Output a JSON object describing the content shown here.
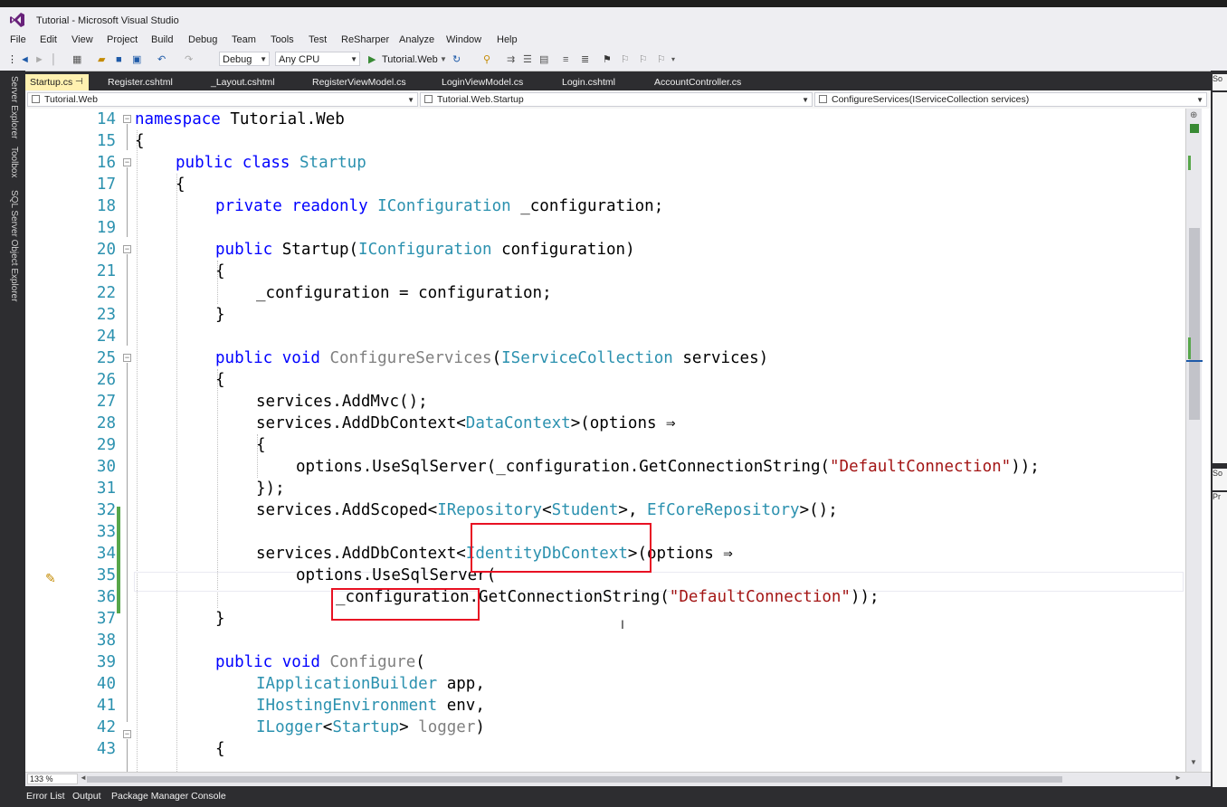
{
  "window": {
    "title": "Tutorial - Microsoft Visual Studio"
  },
  "menu": [
    "File",
    "Edit",
    "View",
    "Project",
    "Build",
    "Debug",
    "Team",
    "Tools",
    "Test",
    "ReSharper",
    "Analyze",
    "Window",
    "Help"
  ],
  "toolbar": {
    "config": "Debug",
    "platform": "Any CPU",
    "start_target": "Tutorial.Web"
  },
  "left_tools": [
    "Server Explorer",
    "Toolbox",
    "SQL Server Object Explorer"
  ],
  "tabs": [
    "Startup.cs",
    "Register.cshtml",
    "_Layout.cshtml",
    "RegisterViewModel.cs",
    "LoginViewModel.cs",
    "Login.cshtml",
    "AccountController.cs"
  ],
  "tab_pin": "⊣",
  "nav": {
    "project": "Tutorial.Web",
    "class": "Tutorial.Web.Startup",
    "member": "ConfigureServices(IServiceCollection services)"
  },
  "editor": {
    "zoom": "133 %",
    "code": {
      "l14a": "namespace",
      "l14b": " Tutorial.Web",
      "l15": "{",
      "l16a": "public",
      "l16b": "class",
      "l16c": "Startup",
      "l17": "{",
      "l18a": "private",
      "l18b": "readonly",
      "l18c": "IConfiguration",
      "l18d": " _configuration;",
      "l20a": "public",
      "l20b": " Startup(",
      "l20c": "IConfiguration",
      "l20d": " configuration)",
      "l21": "{",
      "l22": "_configuration = configuration;",
      "l23": "}",
      "l25a": "public",
      "l25b": "void",
      "l25c": "ConfigureServices",
      "l25d": "(",
      "l25e": "IServiceCollection",
      "l25f": " services)",
      "l26": "{",
      "l27": "services.AddMvc();",
      "l28a": "services.AddDbContext<",
      "l28b": "DataContext",
      "l28c": ">(options ⇒",
      "l29": "{",
      "l30a": "options.UseSqlServer(_configuration.GetConnectionString(",
      "l30b": "\"DefaultConnection\"",
      "l30c": "));",
      "l31": "});",
      "l32a": "services.AddScoped<",
      "l32b": "IRepository",
      "l32c": "<",
      "l32d": "Student",
      "l32e": ">, ",
      "l32f": "EfCoreRepository",
      "l32g": ">();",
      "l34a": "services.AddDbContext<",
      "l34b": "IdentityDbContext",
      "l34c": ">(options ⇒",
      "l35": "options.UseSqlServer(",
      "l36a": "_configuration",
      "l36b": ".GetConnectionString(",
      "l36c": "\"DefaultConnection\"",
      "l36d": "));",
      "l37": "}",
      "l39a": "public",
      "l39b": "void",
      "l39c": "Configure",
      "l39d": "(",
      "l40a": "IApplicationBuilder",
      "l40b": " app,",
      "l41a": "IHostingEnvironment",
      "l41b": " env,",
      "l42a": "ILogger",
      "l42b": "<",
      "l42c": "Startup",
      "l42d": "> ",
      "l42e": "logger",
      "l42f": ")",
      "l43": "{"
    }
  },
  "right_panel": {
    "a": "So",
    "c": "So",
    "d": "Pr"
  },
  "bottom_tabs": [
    "Error List",
    "Output",
    "Package Manager Console"
  ]
}
